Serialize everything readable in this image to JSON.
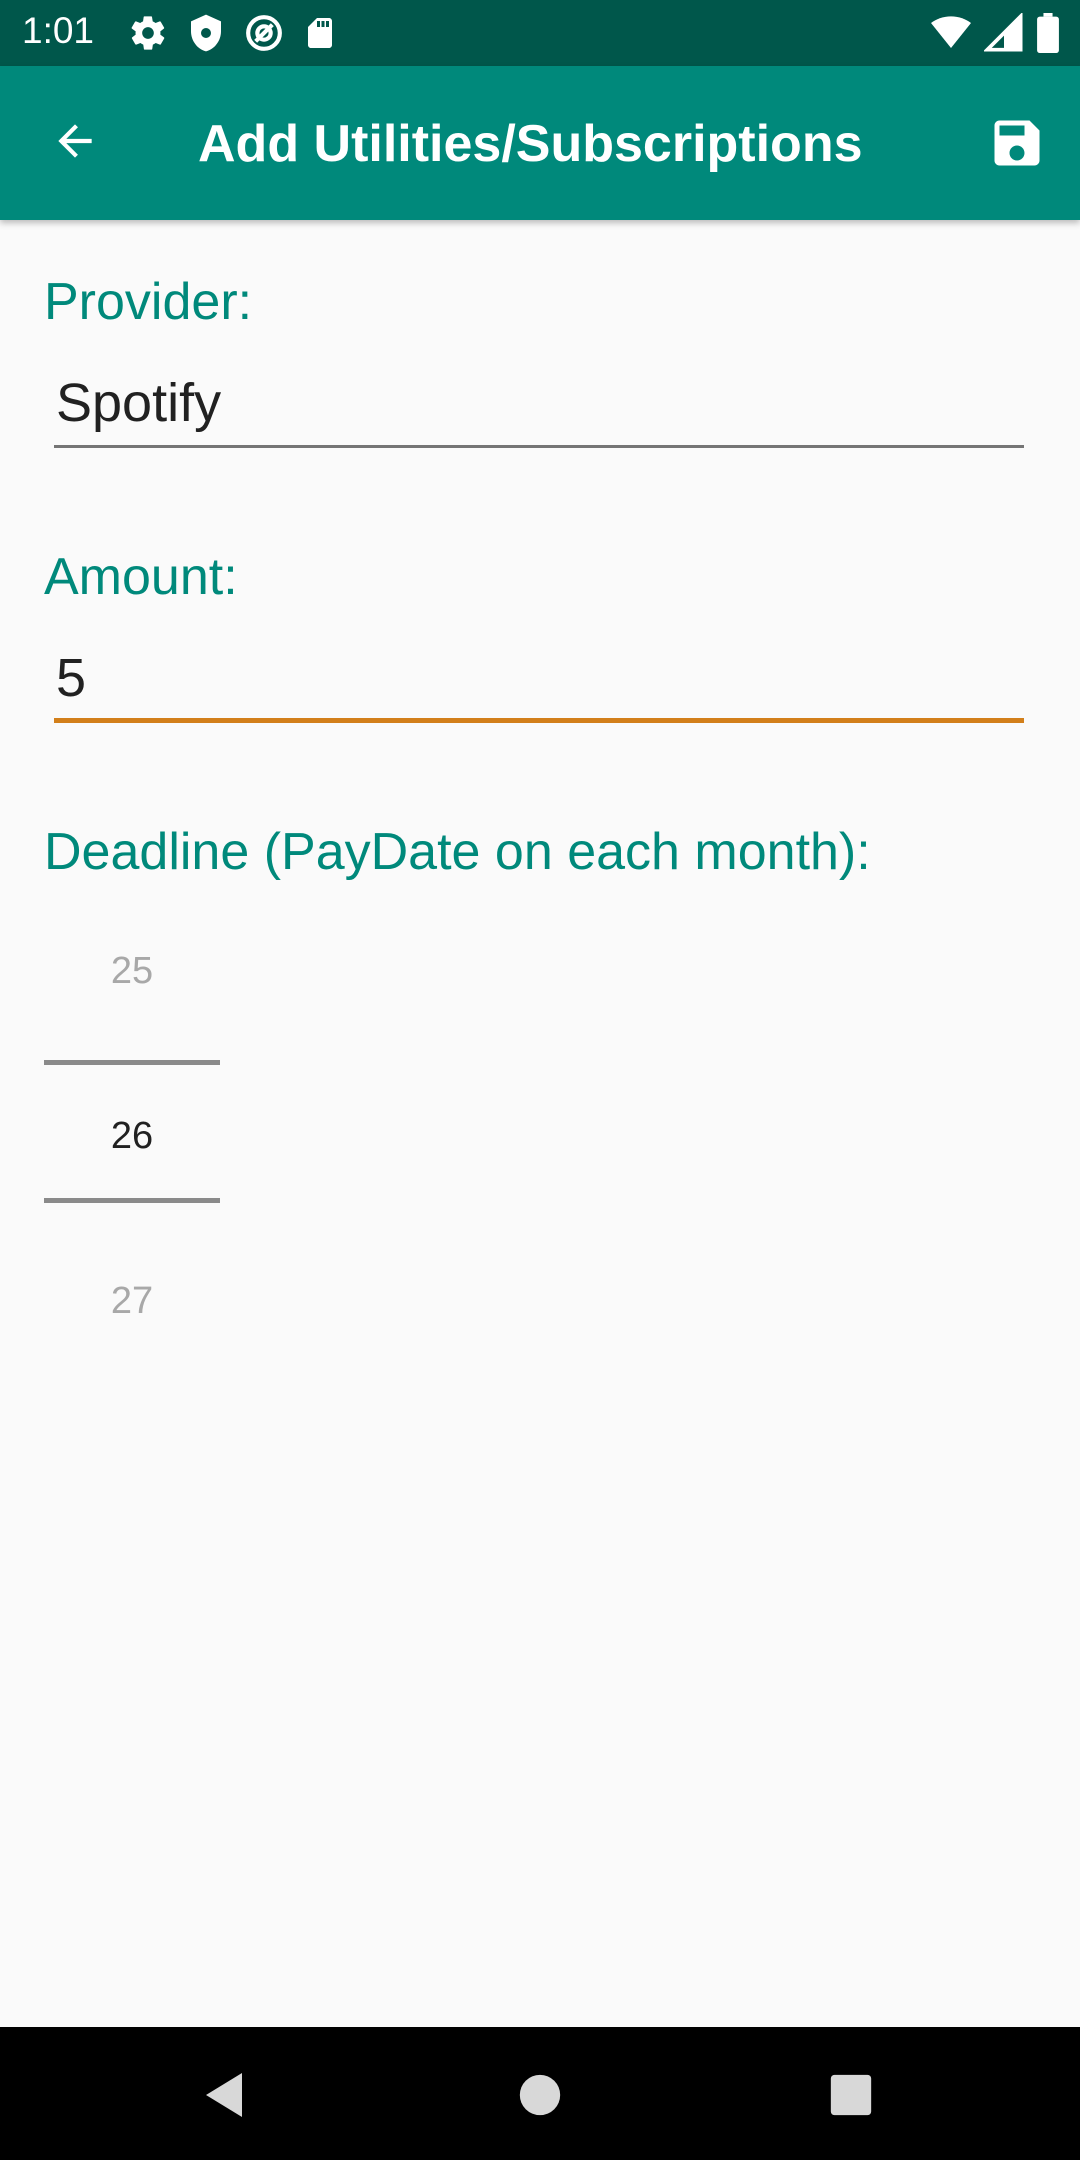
{
  "status_bar": {
    "time": "1:01",
    "left_icons": [
      "gear-icon",
      "shield-icon",
      "at-sign-icon",
      "sd-card-icon"
    ],
    "right_icons": [
      "wifi-icon",
      "signal-icon",
      "battery-icon"
    ]
  },
  "app_bar": {
    "title": "Add Utilities/Subscriptions",
    "back_icon": "arrow-back-icon",
    "save_icon": "save-icon",
    "color": "#00897b",
    "status_color": "#00574b"
  },
  "form": {
    "provider": {
      "label": "Provider:",
      "value": "Spotify"
    },
    "amount": {
      "label": "Amount:",
      "value": "5"
    },
    "deadline": {
      "label": "Deadline (PayDate on each month):",
      "prev": "25",
      "selected": "26",
      "next": "27"
    },
    "accent_color": "#00897b",
    "focus_color": "#d27f1a"
  },
  "nav_bar": {
    "buttons": [
      "back-triangle-icon",
      "home-circle-icon",
      "recents-square-icon"
    ]
  }
}
